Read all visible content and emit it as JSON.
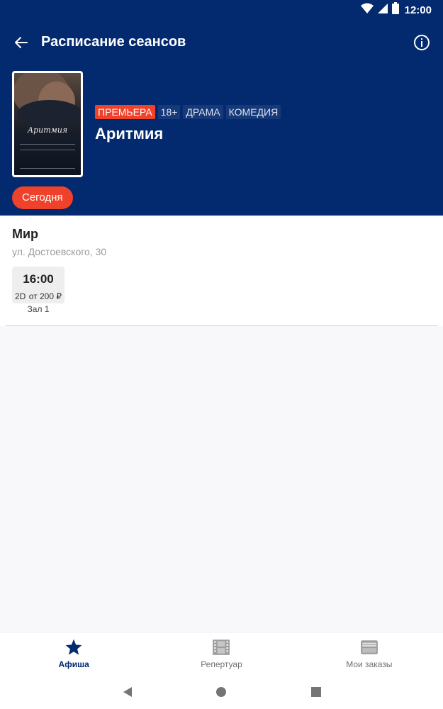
{
  "status_bar": {
    "time": "12:00"
  },
  "appbar": {
    "title": "Расписание сеансов"
  },
  "movie": {
    "poster_title": "Аритмия",
    "tags": {
      "premiere": "ПРЕМЬЕРА",
      "age": "18+",
      "genre1": "ДРАМА",
      "genre2": "КОМЕДИЯ"
    },
    "name": "Аритмия"
  },
  "date_chip": "Сегодня",
  "cinema": {
    "name": "Мир",
    "address": "ул. Достоевского, 30",
    "session": {
      "time": "16:00",
      "format": "2D",
      "price": "от 200 ₽",
      "hall": "Зал 1"
    }
  },
  "bottom_nav": {
    "afisha": "Афиша",
    "repertoire": "Репертуар",
    "orders": "Мои заказы"
  },
  "colors": {
    "header_bg": "#032a6e",
    "accent": "#f0422a"
  }
}
